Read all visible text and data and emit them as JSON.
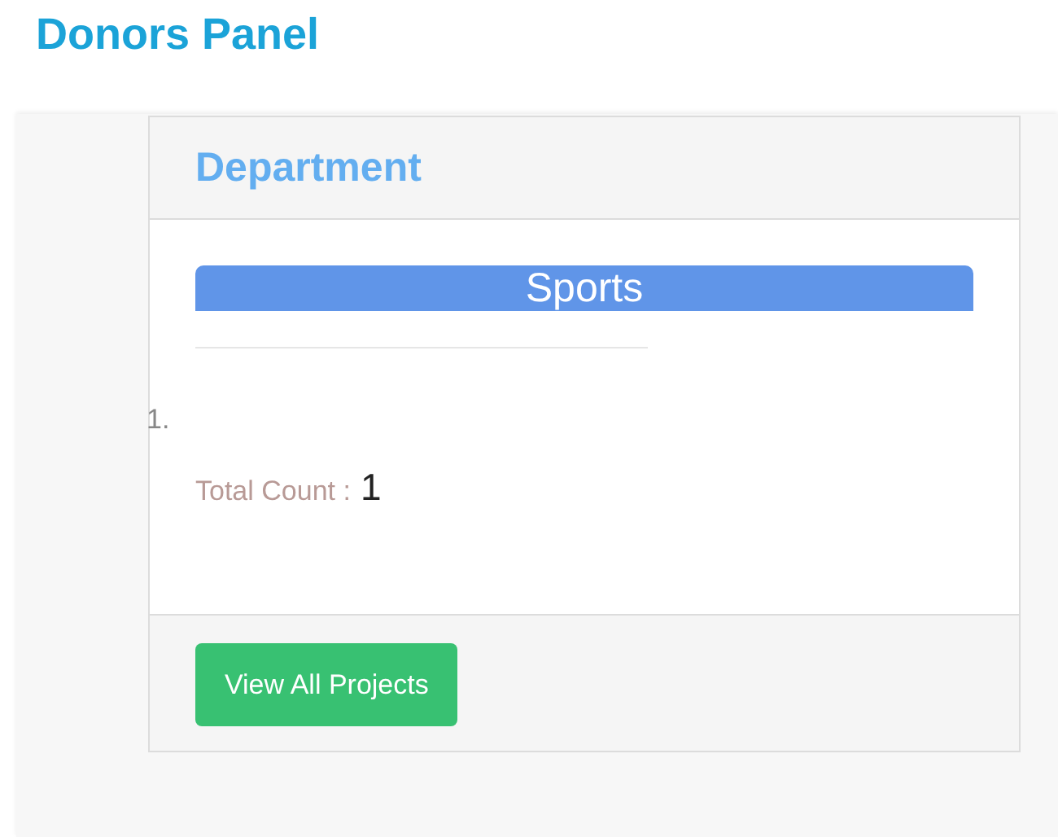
{
  "header": {
    "title": "Donors Panel"
  },
  "card": {
    "title": "Department",
    "category": "Sports",
    "list_marker": "1.",
    "total_label": "Total Count :",
    "total_value": "1",
    "button": "View All Projects"
  }
}
